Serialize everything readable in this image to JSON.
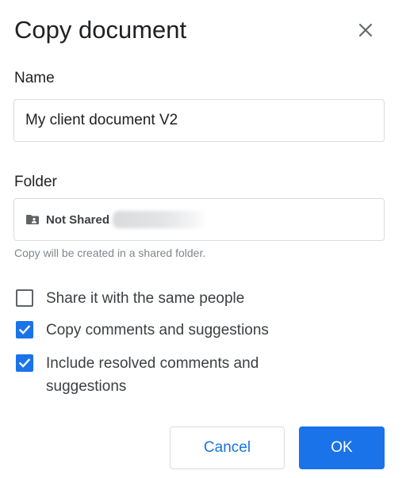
{
  "dialog": {
    "title": "Copy document",
    "close_icon": "close-icon"
  },
  "name": {
    "label": "Name",
    "value": "My client document V2"
  },
  "folder": {
    "label": "Folder",
    "icon": "shared-folder-icon",
    "name": "Not Shared",
    "helper": "Copy will be created in a shared folder."
  },
  "options": [
    {
      "label": "Share it with the same people",
      "checked": false
    },
    {
      "label": "Copy comments and suggestions",
      "checked": true
    },
    {
      "label": "Include resolved comments and suggestions",
      "checked": true
    }
  ],
  "buttons": {
    "cancel": "Cancel",
    "ok": "OK"
  },
  "colors": {
    "accent": "#1a73e8",
    "border": "#dadce0",
    "helper_text": "#80868b"
  }
}
